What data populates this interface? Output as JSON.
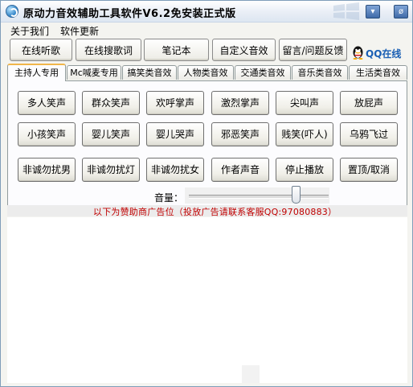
{
  "window": {
    "title": "原动力音效辅助工具软件V6.2免安装正式版",
    "minimize_glyph": "▾",
    "close_glyph": "ø",
    "colors": {
      "title_bg": "#e9eef6",
      "tab_highlight": "#f1b64a",
      "ad_text": "#c00000",
      "qq_text": "#1a5fb4"
    }
  },
  "menu": {
    "items": [
      "关于我们",
      "软件更新"
    ]
  },
  "nav": {
    "buttons": [
      "在线听歌",
      "在线搜歌词",
      "笔记本",
      "自定义音效",
      "留言/问题反馈"
    ],
    "qq_label": "QQ在线",
    "qq_icon": "qq-penguin-icon"
  },
  "tabs": {
    "items": [
      "主持人专用",
      "Mc喊麦专用",
      "搞笑类音效",
      "人物类音效",
      "交通类音效",
      "音乐类音效",
      "生活类音效"
    ],
    "active_index": 0
  },
  "sounds": {
    "rows": [
      [
        "多人笑声",
        "群众笑声",
        "欢呼掌声",
        "激烈掌声",
        "尖叫声",
        "放屁声"
      ],
      [
        "小孩笑声",
        "婴儿笑声",
        "婴儿哭声",
        "邪恶笑声",
        "贱笑(吓人)",
        "乌鸦飞过"
      ],
      [
        "非诚勿扰男",
        "非诚勿扰灯",
        "非诚勿扰女",
        "作者声音",
        "停止播放",
        "置顶/取消"
      ]
    ]
  },
  "volume": {
    "label": "音量：",
    "level": 0.77
  },
  "ad": {
    "notice": "以下为赞助商广告位（投放广告请联系客服QQ:97080883）"
  }
}
